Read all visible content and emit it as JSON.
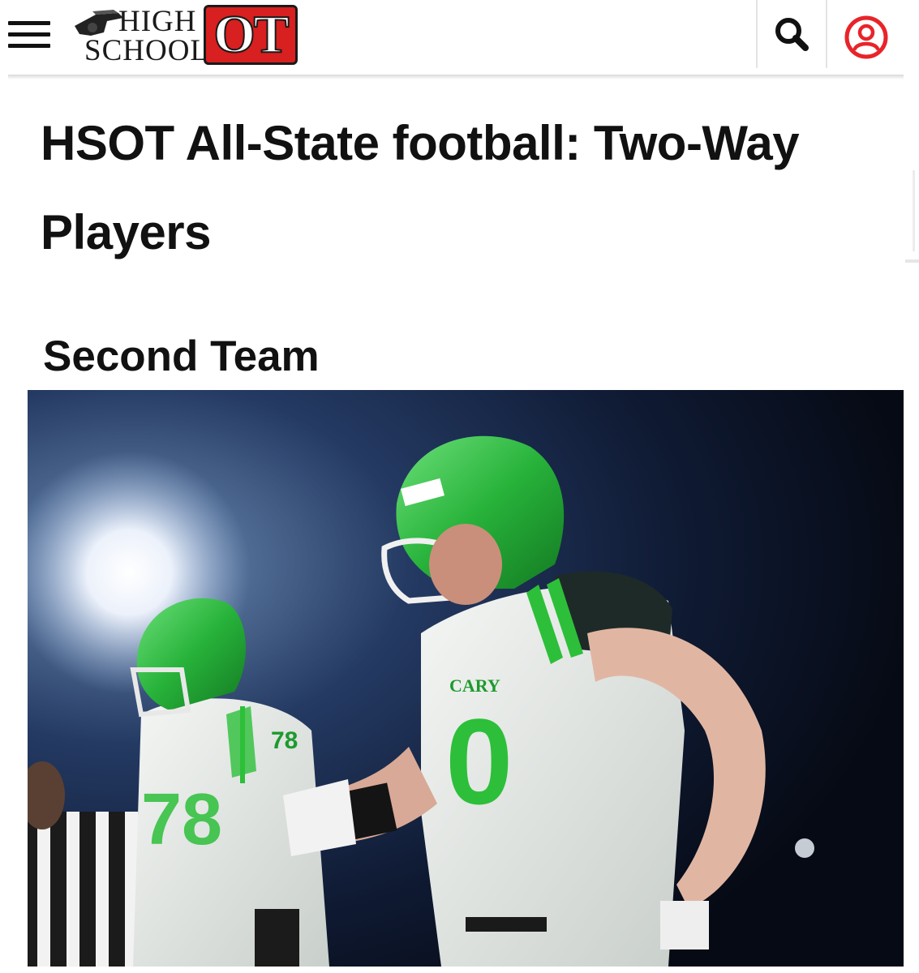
{
  "header": {
    "logo": {
      "line1": "HIGH",
      "line2": "SCHOOL",
      "mark": "OT",
      "brand_color": "#d7201f"
    },
    "icons": {
      "menu": "hamburger-menu-icon",
      "search": "search-icon",
      "account": "account-icon"
    },
    "account_icon_color": "#e8242a"
  },
  "article": {
    "title": "HSOT All-State football: Two-Way Players",
    "section_heading": "Second Team"
  },
  "photo": {
    "jersey_numbers": [
      "78",
      "0"
    ],
    "jersey_wordmark": "CARY",
    "accent_color": "#2dbf3a"
  }
}
